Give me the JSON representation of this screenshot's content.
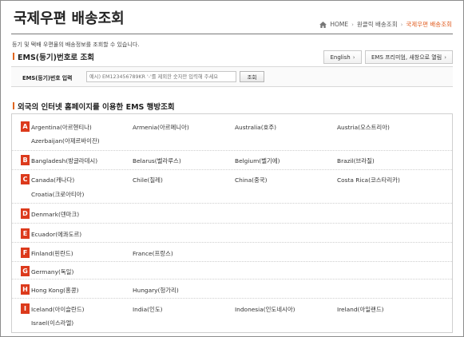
{
  "page": {
    "title": "국제우편 배송조회",
    "intro": "등기 및 택배 우편물의 배송정보를 조회할 수 있습니다."
  },
  "breadcrumb": {
    "home": "HOME",
    "parent": "원클릭 배송조회",
    "current": "국제우편 배송조회"
  },
  "ems_search": {
    "section_title": "EMS(등기)번호로 조회",
    "english_button": "English",
    "popup_button": "EMS 프리미엄, 새창으로 열림",
    "label": "EMS(등기)번호 입력",
    "placeholder": "예시) EM123456789KR '-'를 제외한 숫자만 입력해 주세요",
    "submit": "조회"
  },
  "country_section": {
    "title": "외국의 인터넷 홈페이지를 이용한 EMS 행방조회",
    "groups": [
      {
        "letter": "A",
        "countries": [
          "Argentina(아르헨티나)",
          "Armenia(아르메니아)",
          "Australia(호주)",
          "Austria(오스트리아)",
          "Azerbaijan(아제르바이잔)"
        ]
      },
      {
        "letter": "B",
        "countries": [
          "Bangladesh(방글라데시)",
          "Belarus(벨라루스)",
          "Belgium(벨기에)",
          "Brazil(브라질)"
        ]
      },
      {
        "letter": "C",
        "countries": [
          "Canada(캐나다)",
          "Chile(칠레)",
          "China(중국)",
          "Costa Rica(코스타리카)",
          "Croatia(크로아티아)"
        ]
      },
      {
        "letter": "D",
        "countries": [
          "Denmark(덴마크)"
        ]
      },
      {
        "letter": "E",
        "countries": [
          "Ecuador(에콰도르)"
        ]
      },
      {
        "letter": "F",
        "countries": [
          "Finland(핀란드)",
          "France(프랑스)"
        ]
      },
      {
        "letter": "G",
        "countries": [
          "Germany(독일)"
        ]
      },
      {
        "letter": "H",
        "countries": [
          "Hong Kong(홍콩)",
          "Hungary(헝가리)"
        ]
      },
      {
        "letter": "I",
        "countries": [
          "Iceland(아이슬란드)",
          "India(인도)",
          "Indonesia(인도네시아)",
          "Ireland(아일랜드)",
          "Israel(이스라엘)"
        ]
      }
    ]
  },
  "colors": {
    "accent": "#e0651f",
    "letter_badge": "#dc3a1c",
    "breadcrumb_current": "#e05a1c"
  }
}
